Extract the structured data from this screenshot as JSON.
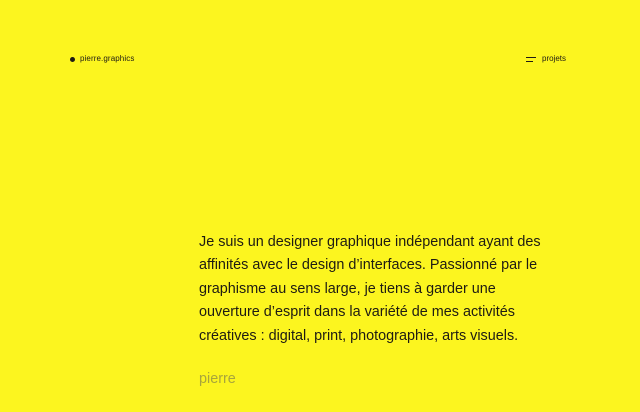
{
  "site": {
    "logo_text": "pierre.graphics",
    "menu_label": "projets"
  },
  "intro": {
    "text": "Je suis un designer graphique indépendant ayant des affinités avec le design d’interfaces. Passionné par le graphisme au sens large, je tiens à garder une ouverture d’esprit dans la variété de mes activités créatives : digital, print, photographie, arts visuels.",
    "signature": "pierre"
  },
  "icons": {
    "logo_dot": "dot-icon",
    "menu": "menu-icon"
  },
  "colors": {
    "background": "#fcf51f",
    "text": "#1e1b13",
    "signature": "#a8a53c"
  }
}
